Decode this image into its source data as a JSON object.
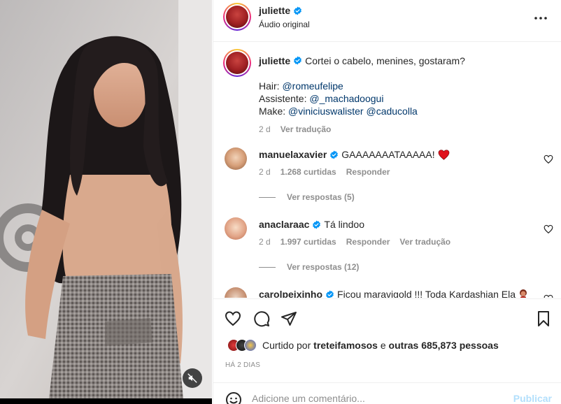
{
  "header": {
    "username": "juliette",
    "audio": "Áudio original",
    "more_icon": "more-horizontal-icon"
  },
  "caption": {
    "username": "juliette",
    "text": "Cortei o cabelo, menines, gostaram?",
    "hair_label": "Hair:",
    "hair_mention": "@romeufelipe",
    "assistant_label": "Assistente:",
    "assistant_mention": "@_machadoogui",
    "make_label": "Make:",
    "make_mention_1": "@viniciuswalister",
    "make_mention_2": "@caducolla",
    "time": "2 d",
    "translate": "Ver tradução"
  },
  "comments": [
    {
      "username": "manuelaxavier",
      "text": "GAAAAAAATAAAAA!",
      "emoji": "❤️",
      "time": "2 d",
      "likes": "1.268 curtidas",
      "reply": "Responder",
      "view_replies": "Ver respostas (5)"
    },
    {
      "username": "anaclaraac",
      "text": "Tá lindoo",
      "time": "2 d",
      "likes": "1.997 curtidas",
      "reply": "Responder",
      "translate": "Ver tradução",
      "view_replies": "Ver respostas (12)"
    },
    {
      "username": "carolpeixinho",
      "text": "Ficou maravigold !!! Toda Kardashian Ela"
    }
  ],
  "actions": {
    "like_icon": "heart-icon",
    "comment_icon": "comment-bubble-icon",
    "share_icon": "paper-plane-icon",
    "save_icon": "bookmark-icon"
  },
  "likes": {
    "prefix": "Curtido por",
    "user": "treteifamosos",
    "connector": "e",
    "others": "outras 685,873 pessoas"
  },
  "time_ago": "HÁ 2 DIAS",
  "add_comment": {
    "placeholder": "Adicione um comentário...",
    "publish": "Publicar",
    "emoji_icon": "smiley-icon"
  },
  "colors": {
    "verified": "#0095f6",
    "link": "#00376b",
    "secondary_text": "#8e8e8e",
    "publish_disabled": "#b2dffc",
    "border": "#efefef"
  }
}
